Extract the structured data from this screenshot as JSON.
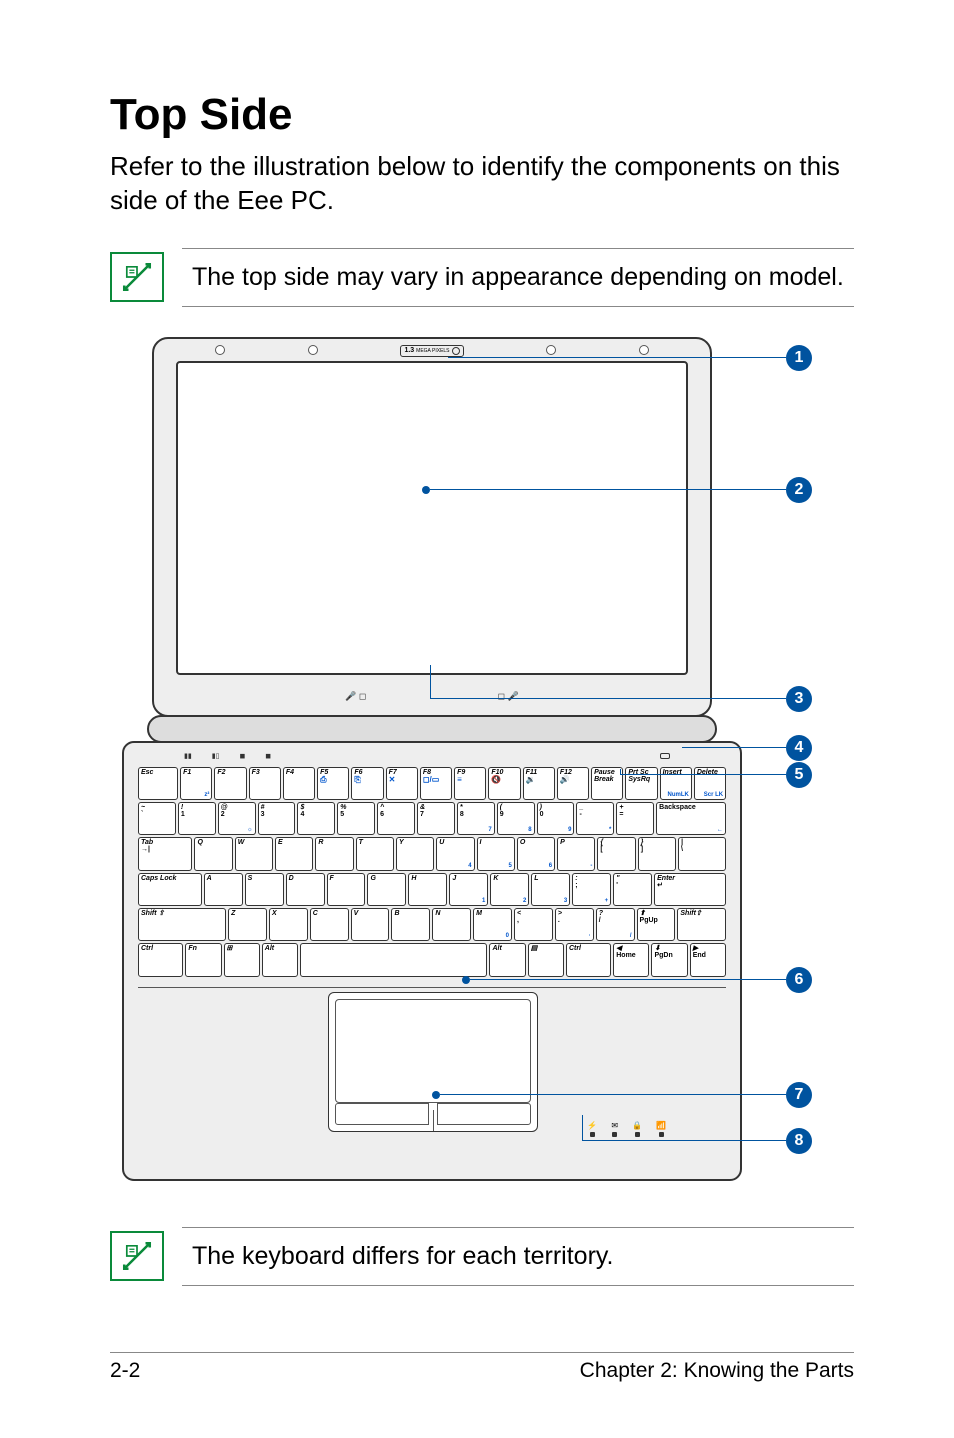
{
  "heading": "Top Side",
  "intro": "Refer to the illustration below to identify the components on this side of the Eee PC.",
  "note_top": "The top side may vary in appearance depending on model.",
  "note_bottom": "The keyboard differs for each territory.",
  "callouts": {
    "n1": "1",
    "n2": "2",
    "n3": "3",
    "n4": "4",
    "n5": "5",
    "n6": "6",
    "n7": "7",
    "n8": "8"
  },
  "cam_label": "1.3",
  "cam_sub": "MEGA PIXELS",
  "keyboard": {
    "r1": [
      "Esc",
      "F1",
      "F2",
      "F3",
      "F4",
      "F5",
      "F6",
      "F7",
      "F8",
      "F9",
      "F10",
      "F11",
      "F12",
      "Pause Break",
      "Prt Sc SysRq",
      "Insert",
      "Delete"
    ],
    "r1_sub": [
      "",
      "z²",
      "",
      "",
      "",
      "",
      "",
      "",
      "",
      "",
      "",
      "",
      "",
      "",
      "",
      "NumLK",
      "Scr LK"
    ],
    "r1_ico": [
      "",
      "",
      "",
      "",
      "",
      "⎙",
      "⎘",
      "✕",
      "◻/▭",
      "≡",
      "🔇",
      "🔉",
      "🔊",
      "",
      "",
      "",
      ""
    ],
    "r2_top": [
      "~",
      "!",
      "@",
      "#",
      "$",
      "%",
      "^",
      "&",
      "*",
      "(",
      ")",
      "_",
      "+",
      ""
    ],
    "r2_bot": [
      "`",
      "1",
      "2",
      "3",
      "4",
      "5",
      "6",
      "7",
      "8",
      "9",
      "0",
      "-",
      "=",
      "Backspace"
    ],
    "r2_sub": [
      "",
      "",
      "☼",
      "",
      "",
      "",
      "",
      "",
      "7",
      "8",
      "9",
      "*",
      "",
      "←"
    ],
    "r3": [
      "Tab",
      "Q",
      "W",
      "E",
      "R",
      "T",
      "Y",
      "U",
      "I",
      "O",
      "P",
      "{",
      "}",
      "|"
    ],
    "r3_bot": [
      "→|",
      "",
      "",
      "",
      "",
      "",
      "",
      "",
      "",
      "",
      "",
      "[",
      "]",
      "\\"
    ],
    "r3_sub": [
      "",
      "",
      "",
      "",
      "",
      "",
      "",
      "4",
      "5",
      "6",
      "-",
      "",
      "",
      ""
    ],
    "r4": [
      "Caps Lock",
      "A",
      "S",
      "D",
      "F",
      "G",
      "H",
      "J",
      "K",
      "L",
      ":",
      "\"",
      "Enter"
    ],
    "r4_bot": [
      "",
      "",
      "",
      "",
      "",
      "",
      "",
      "",
      "",
      "",
      ";",
      "'",
      "↵"
    ],
    "r4_sub": [
      "",
      "",
      "",
      "",
      "",
      "",
      "",
      "1",
      "2",
      "3",
      "+",
      "",
      ""
    ],
    "r5": [
      "Shift ⇧",
      "Z",
      "X",
      "C",
      "V",
      "B",
      "N",
      "M",
      "<",
      ">",
      "?",
      "⬆",
      "Shift⇧"
    ],
    "r5_bot": [
      "",
      "",
      "",
      "",
      "",
      "",
      "",
      "",
      ",",
      ".",
      "/",
      "PgUp",
      ""
    ],
    "r5_sub": [
      "",
      "",
      "",
      "",
      "",
      "",
      "",
      "0",
      "",
      "·",
      "/",
      "",
      ""
    ],
    "r6": [
      "Ctrl",
      "Fn",
      "⊞",
      "Alt",
      "",
      "Alt",
      "▤",
      "Ctrl",
      "◀",
      "⬇",
      "▶"
    ],
    "r6_bot": [
      "",
      "",
      "",
      "",
      "",
      "",
      "",
      "",
      "Home",
      "PgDn",
      "End"
    ]
  },
  "leds": [
    "⚡",
    "✉",
    "🔒",
    "📶"
  ],
  "ind_left": [
    "▮▮",
    "▮▯",
    "◼",
    "◼"
  ],
  "mic_l": "🎤 ◻",
  "mic_r": "◻ 🎤",
  "footer_left": "2-2",
  "footer_right": "Chapter 2: Knowing the Parts"
}
